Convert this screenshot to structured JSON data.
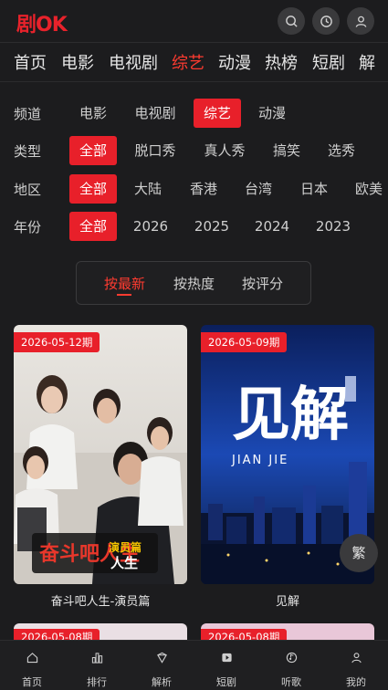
{
  "app": {
    "logo": "剧OK"
  },
  "header": {
    "icons": [
      "search-icon",
      "history-icon",
      "user-icon"
    ]
  },
  "nav": {
    "items": [
      "首页",
      "电影",
      "电视剧",
      "综艺",
      "动漫",
      "热榜",
      "短剧",
      "解"
    ],
    "active_index": 3
  },
  "filters": {
    "channel": {
      "label": "频道",
      "options": [
        "电影",
        "电视剧",
        "综艺",
        "动漫"
      ],
      "active_index": 2
    },
    "type": {
      "label": "类型",
      "options": [
        "全部",
        "脱口秀",
        "真人秀",
        "搞笑",
        "选秀"
      ],
      "active_index": 0
    },
    "region": {
      "label": "地区",
      "options": [
        "全部",
        "大陆",
        "香港",
        "台湾",
        "日本",
        "欧美"
      ],
      "active_index": 0
    },
    "year": {
      "label": "年份",
      "options": [
        "全部",
        "2026",
        "2025",
        "2024",
        "2023"
      ],
      "active_index": 0
    }
  },
  "sort": {
    "options": [
      "按最新",
      "按热度",
      "按评分"
    ],
    "active_index": 0
  },
  "cards": [
    {
      "badge": "2026-05-12期",
      "title": "奋斗吧人生-演员篇",
      "poster_text": "奋斗吧人生",
      "poster_sub": "演员篇"
    },
    {
      "badge": "2026-05-09期",
      "title": "见解",
      "poster_text": "见解",
      "poster_sub": "JIAN JIE"
    }
  ],
  "next_cards": [
    {
      "badge": "2026-05-08期"
    },
    {
      "badge": "2026-05-08期"
    }
  ],
  "floating": {
    "trad_label": "繁"
  },
  "tabbar": {
    "items": [
      {
        "label": "首页",
        "icon": "home-icon"
      },
      {
        "label": "排行",
        "icon": "ranking-icon"
      },
      {
        "label": "解析",
        "icon": "analysis-icon"
      },
      {
        "label": "短剧",
        "icon": "short-drama-icon"
      },
      {
        "label": "听歌",
        "icon": "music-icon"
      },
      {
        "label": "我的",
        "icon": "profile-icon"
      }
    ]
  },
  "colors": {
    "accent": "#e8202a",
    "background": "#1c1c1e"
  }
}
